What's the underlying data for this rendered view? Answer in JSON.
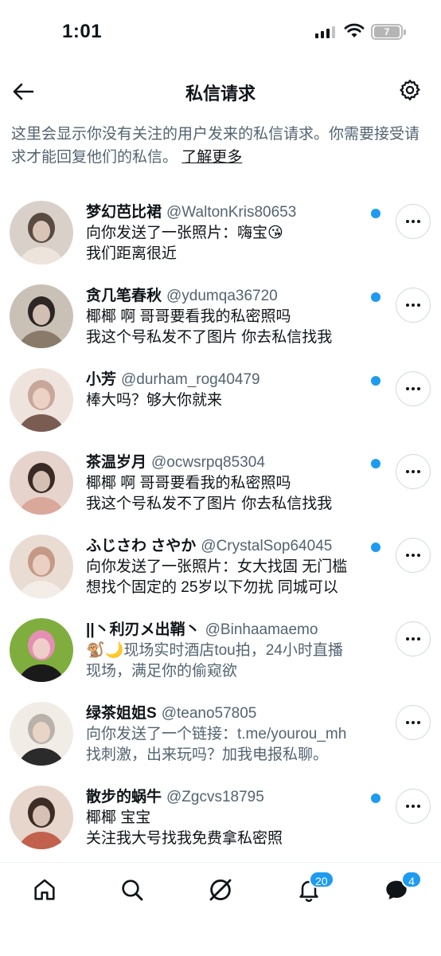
{
  "status_bar": {
    "time": "1:01",
    "battery": "7"
  },
  "header": {
    "title": "私信请求",
    "back_icon": "arrow-left-icon",
    "settings_icon": "gear-icon"
  },
  "intro": {
    "text": "这里会显示你没有关注的用户发来的私信请求。你需要接受请求才能回复他们的私信。",
    "link": "了解更多"
  },
  "requests": [
    {
      "name": "梦幻芭比裙",
      "handle": "@WaltonKris80653",
      "line1": "向你发送了一张照片：嗨宝😘",
      "line2": "我们距离很近",
      "unread": true,
      "avatar_colors": [
        "#d9d1c9",
        "#5a4b42",
        "#ede4dc"
      ]
    },
    {
      "name": "贪几笔春秋",
      "handle": "@ydumqa36720",
      "line1": "椰椰 啊 哥哥要看我的私密照吗",
      "line2": "我这个号私发不了图片  你去私信找我",
      "unread": true,
      "avatar_colors": [
        "#c9c1b6",
        "#2c2624",
        "#8a7a6a"
      ]
    },
    {
      "name": "小芳",
      "handle": "@durham_rog40479",
      "line1": "棒大吗？够大你就来",
      "line2": "",
      "unread": true,
      "avatar_colors": [
        "#efe4dd",
        "#c8a79a",
        "#7a5c52"
      ]
    },
    {
      "name": "茶温岁月",
      "handle": "@ocwsrpq85304",
      "line1": "椰椰 啊 哥哥要看我的私密照吗",
      "line2": "我这个号私发不了图片  你去私信找我",
      "unread": true,
      "avatar_colors": [
        "#e6d3cc",
        "#3a2a26",
        "#d9a89a"
      ]
    },
    {
      "name": "ふじさわ さやか",
      "handle": "@CrystalSop64045",
      "line1": "向你发送了一张照片：女大找固 无门槛",
      "line2": "想找个固定的 25岁以下勿扰 同城可以",
      "unread": true,
      "avatar_colors": [
        "#e9dcd3",
        "#c49a86",
        "#f4ece6"
      ]
    },
    {
      "name": "||丶利刃メ出鞘丶",
      "handle": "@Binhaamaemo",
      "line1": "🐒🌙现场实时酒店tou拍，24小时直播",
      "line2": "现场，满足你的偷窥欲",
      "unread": false,
      "avatar_colors": [
        "#7fae3e",
        "#e58fb4",
        "#1a1a1a"
      ]
    },
    {
      "name": "绿茶姐姐S",
      "handle": "@teano57805",
      "line1": "向你发送了一个链接：t.me/yourou_mh",
      "line2": "找刺激，出来玩吗？加我电报私聊。",
      "unread": false,
      "avatar_colors": [
        "#f1ece6",
        "#b9b2ab",
        "#2b2b2b"
      ]
    },
    {
      "name": "散步的蜗牛",
      "handle": "@Zgcvs18795",
      "line1": "椰椰 宝宝",
      "line2": "关注我大号找我免费拿私密照",
      "unread": true,
      "avatar_colors": [
        "#e7d6cb",
        "#3d2c26",
        "#c2614d"
      ]
    }
  ],
  "bottom_nav": {
    "items": [
      {
        "icon": "home-icon",
        "badge": ""
      },
      {
        "icon": "search-icon",
        "badge": ""
      },
      {
        "icon": "grok-icon",
        "badge": ""
      },
      {
        "icon": "bell-icon",
        "badge": "20"
      },
      {
        "icon": "messages-icon",
        "badge": "4"
      }
    ]
  },
  "colors": {
    "accent": "#1d9bf0",
    "text": "#0f1419",
    "secondary": "#536471",
    "border": "#cfd9de"
  }
}
